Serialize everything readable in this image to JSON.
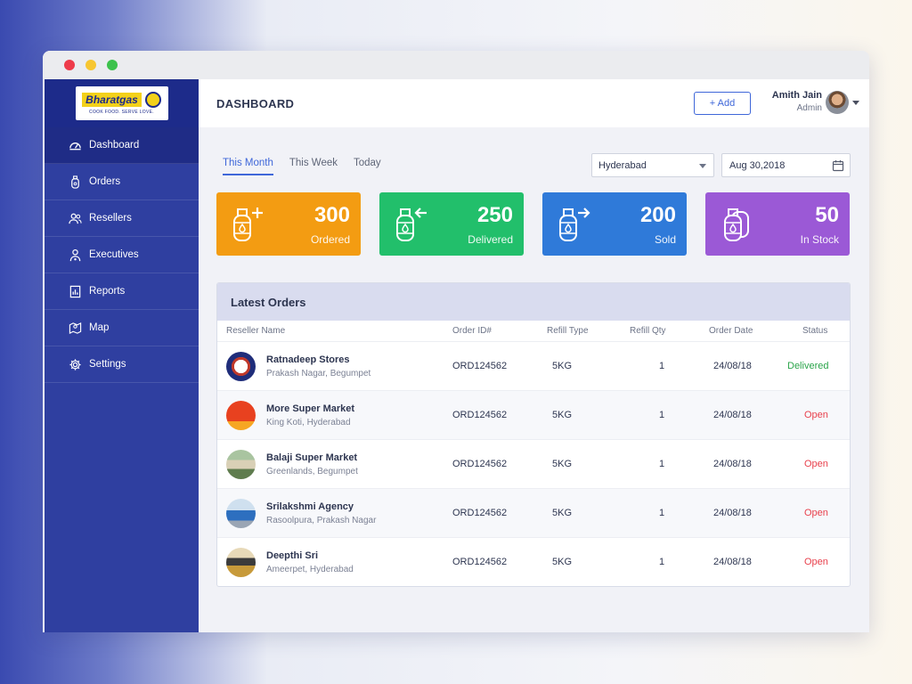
{
  "brand": {
    "name": "Bharatgas",
    "tagline": "COOK FOOD. SERVE LOVE."
  },
  "sidebar": {
    "items": [
      {
        "label": "Dashboard",
        "icon": "speedometer-icon",
        "active": true
      },
      {
        "label": "Orders",
        "icon": "gas-cylinder-icon",
        "active": false
      },
      {
        "label": "Resellers",
        "icon": "users-icon",
        "active": false
      },
      {
        "label": "Executives",
        "icon": "executive-icon",
        "active": false
      },
      {
        "label": "Reports",
        "icon": "report-icon",
        "active": false
      },
      {
        "label": "Map",
        "icon": "map-icon",
        "active": false
      },
      {
        "label": "Settings",
        "icon": "gear-icon",
        "active": false
      }
    ]
  },
  "header": {
    "title": "DASHBOARD",
    "add_label": "+ Add",
    "user": {
      "name": "Amith Jain",
      "role": "Admin"
    }
  },
  "filters": {
    "tabs": [
      {
        "label": "This Month",
        "active": true
      },
      {
        "label": "This Week",
        "active": false
      },
      {
        "label": "Today",
        "active": false
      }
    ],
    "city": "Hyderabad",
    "date": "Aug 30,2018"
  },
  "stats": [
    {
      "value": "300",
      "label": "Ordered",
      "color": "#f39c12",
      "icon": "cylinder-plus-icon"
    },
    {
      "value": "250",
      "label": "Delivered",
      "color": "#22bf6b",
      "icon": "cylinder-in-icon"
    },
    {
      "value": "200",
      "label": "Sold",
      "color": "#2f7ad9",
      "icon": "cylinder-out-icon"
    },
    {
      "value": "50",
      "label": "In Stock",
      "color": "#9b59d6",
      "icon": "cylinders-stock-icon"
    }
  ],
  "orders": {
    "title": "Latest Orders",
    "columns": [
      "Reseller Name",
      "Order ID#",
      "Refill Type",
      "Refill Qty",
      "Order Date",
      "Status"
    ],
    "rows": [
      {
        "name": "Ratnadeep Stores",
        "address": "Prakash Nagar, Begumpet",
        "order_id": "ORD124562",
        "type": "5KG",
        "qty": "1",
        "date": "24/08/18",
        "status": "Delivered"
      },
      {
        "name": "More Super Market",
        "address": "King Koti, Hyderabad",
        "order_id": "ORD124562",
        "type": "5KG",
        "qty": "1",
        "date": "24/08/18",
        "status": "Open"
      },
      {
        "name": "Balaji Super Market",
        "address": "Greenlands, Begumpet",
        "order_id": "ORD124562",
        "type": "5KG",
        "qty": "1",
        "date": "24/08/18",
        "status": "Open"
      },
      {
        "name": "Srilakshmi Agency",
        "address": "Rasoolpura, Prakash Nagar",
        "order_id": "ORD124562",
        "type": "5KG",
        "qty": "1",
        "date": "24/08/18",
        "status": "Open"
      },
      {
        "name": "Deepthi Sri",
        "address": "Ameerpet, Hyderabad",
        "order_id": "ORD124562",
        "type": "5KG",
        "qty": "1",
        "date": "24/08/18",
        "status": "Open"
      }
    ]
  },
  "colors": {
    "status_delivered": "#2aa44a",
    "status_open": "#e8404c",
    "accent": "#3f67d9"
  }
}
